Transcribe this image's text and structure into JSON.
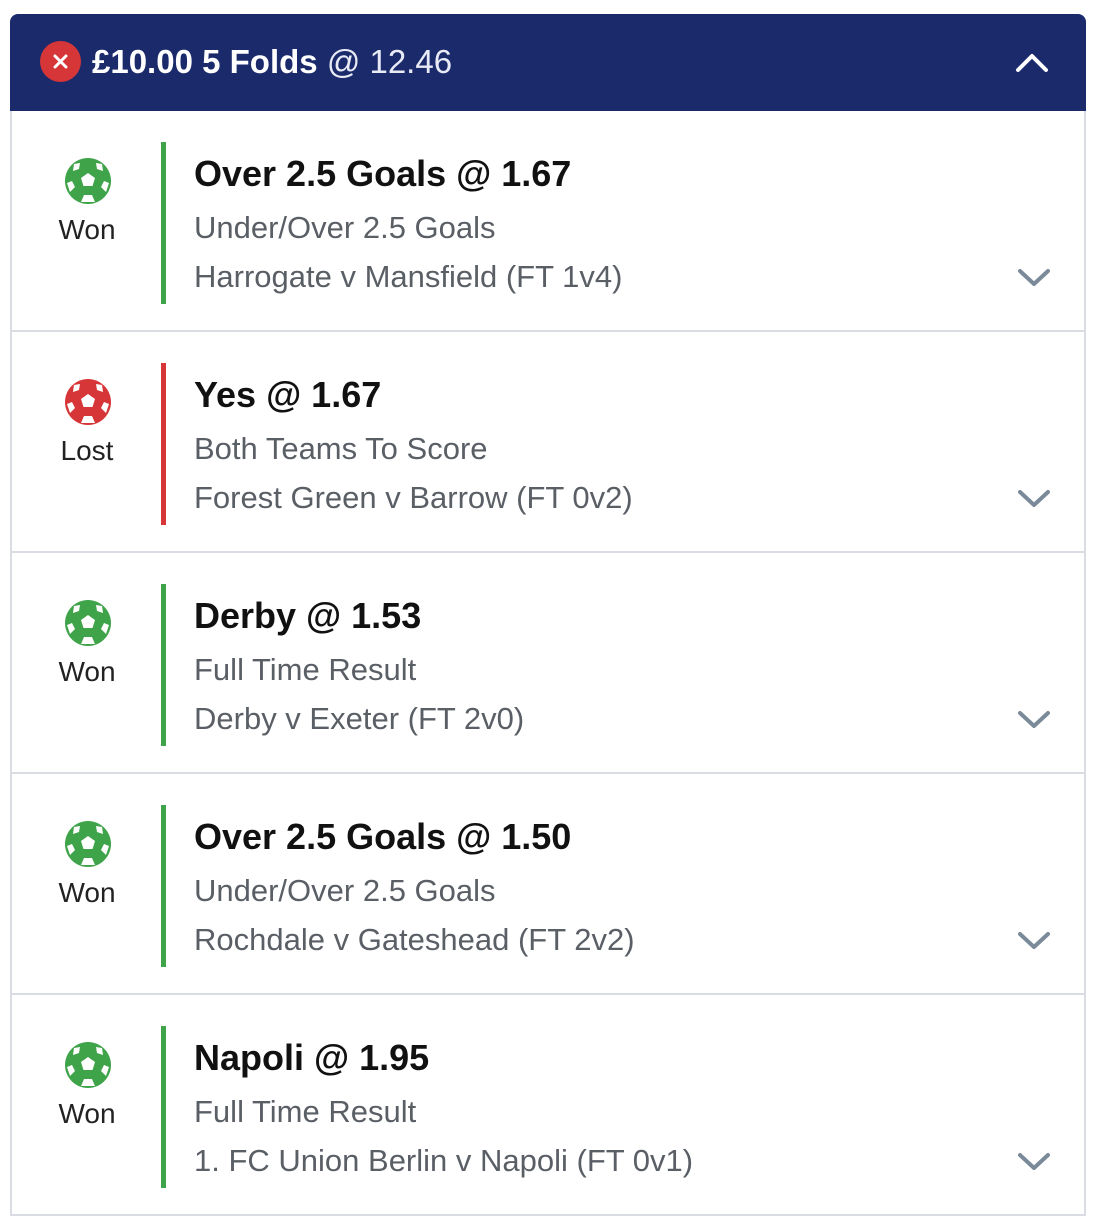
{
  "header": {
    "stake": "£10.00",
    "bet_type": "5 Folds",
    "odds": "@ 12.46",
    "status_icon": "close-icon",
    "toggle_icon": "chevron-up-icon"
  },
  "colors": {
    "header_bg": "#1b2a6b",
    "won": "#3fa349",
    "lost": "#d63638"
  },
  "legs": [
    {
      "status": "won",
      "result": "Won",
      "selection": "Over 2.5 Goals @ 1.67",
      "market": "Under/Over 2.5 Goals",
      "event": "Harrogate v Mansfield (FT 1v4)"
    },
    {
      "status": "lost",
      "result": "Lost",
      "selection": "Yes @ 1.67",
      "market": "Both Teams To Score",
      "event": "Forest Green v Barrow (FT 0v2)"
    },
    {
      "status": "won",
      "result": "Won",
      "selection": "Derby @ 1.53",
      "market": "Full Time Result",
      "event": "Derby v Exeter (FT 2v0)"
    },
    {
      "status": "won",
      "result": "Won",
      "selection": "Over 2.5 Goals @ 1.50",
      "market": "Under/Over 2.5 Goals",
      "event": "Rochdale v Gateshead (FT 2v2)"
    },
    {
      "status": "won",
      "result": "Won",
      "selection": "Napoli @ 1.95",
      "market": "Full Time Result",
      "event": "1. FC Union Berlin v Napoli (FT 0v1)"
    }
  ]
}
